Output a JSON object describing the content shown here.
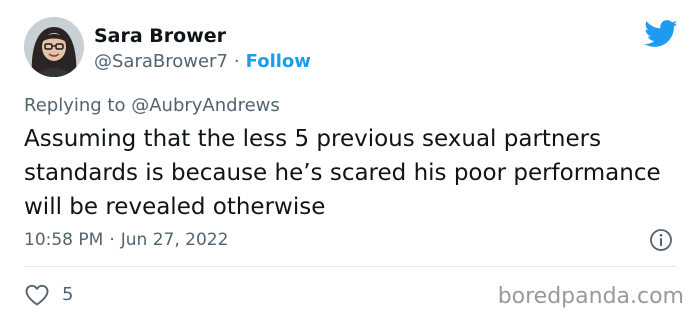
{
  "author": {
    "name": "Sara Brower",
    "handle": "@SaraBrower7",
    "separator": "·",
    "follow_label": "Follow",
    "avatar_icon": "profile-photo"
  },
  "brand_icon": "twitter-bird-icon",
  "reply": {
    "prefix": "Replying to",
    "to": "@AubryAndrews"
  },
  "text": "Assuming that the less 5 previous sexual partners standards is because he’s scared his poor performance will be revealed otherwise",
  "meta": {
    "time": "10:58 PM",
    "separator": "·",
    "date": "Jun 27, 2022"
  },
  "engagement": {
    "likes": "5"
  },
  "watermark": "boredpanda.com",
  "colors": {
    "accent": "#1d9bf0",
    "text": "#0f1419",
    "muted": "#536471",
    "divider": "#e1e8ed"
  }
}
